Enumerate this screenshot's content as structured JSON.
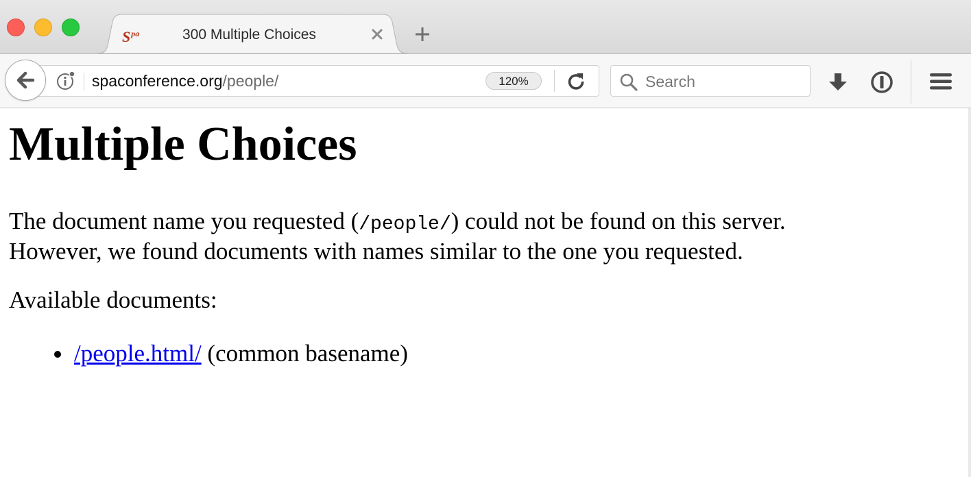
{
  "window": {
    "traffic_lights": [
      "close",
      "minimize",
      "zoom"
    ],
    "colors": {
      "close": "#fc5f57",
      "minimize": "#fdbc2e",
      "zoom": "#28c840"
    }
  },
  "tab": {
    "favicon_text": "S",
    "favicon_sup": "pa",
    "title": "300 Multiple Choices",
    "close_icon": "close-icon"
  },
  "toolbar": {
    "url_host": "spaconference.org",
    "url_path": "/people/",
    "zoom": "120%",
    "search_placeholder": "Search",
    "icons": [
      "back-arrow-icon",
      "info-icon",
      "reload-icon",
      "search-icon",
      "download-icon",
      "onepassword-icon",
      "hamburger-menu-icon"
    ]
  },
  "page": {
    "heading": "Multiple Choices",
    "para_before": "The document name you requested (",
    "para_code": "/people/",
    "para_after": ") could not be found on this server.",
    "para_line2": "However, we found documents with names similar to the one you requested.",
    "available_label": "Available documents:",
    "documents": [
      {
        "link": "/people.html/",
        "note": " (common basename)"
      }
    ],
    "link_color": "#0000ee"
  }
}
